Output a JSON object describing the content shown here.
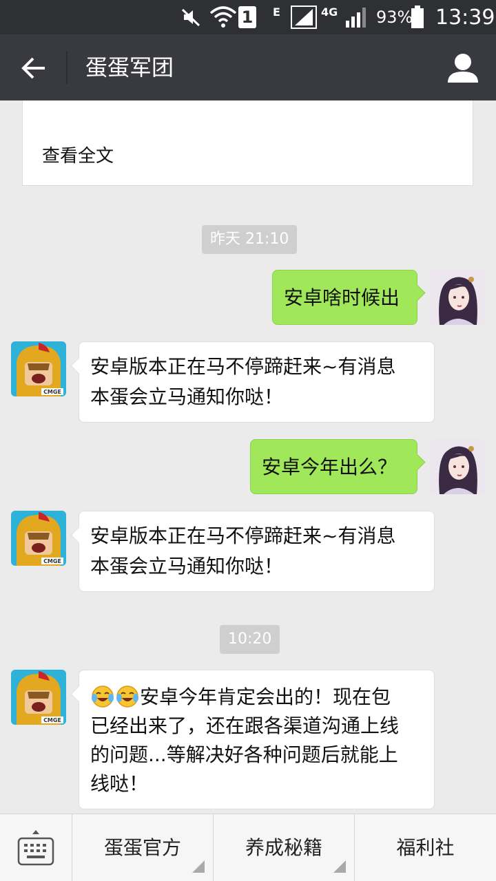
{
  "status_bar": {
    "sim_slot": "1",
    "network_e": "E",
    "network_4g": "4G",
    "battery_percent": "93%",
    "battery_level": 0.93,
    "time": "13:39"
  },
  "header": {
    "title": "蛋蛋军团",
    "back_icon": "arrow-left-icon",
    "profile_icon": "person-icon"
  },
  "article": {
    "read_all": "查看全文"
  },
  "messages": [
    {
      "type": "timestamp",
      "text": "昨天 21:10"
    },
    {
      "type": "sent",
      "text": "安卓啥时候出"
    },
    {
      "type": "received",
      "lines": [
        "安卓版本正在马不停蹄赶来~有消息",
        "本蛋会立马通知你哒！"
      ]
    },
    {
      "type": "sent",
      "text": "安卓今年出么？"
    },
    {
      "type": "received",
      "lines": [
        "安卓版本正在马不停蹄赶来~有消息",
        "本蛋会立马通知你哒！"
      ]
    },
    {
      "type": "timestamp",
      "text": "10:20"
    },
    {
      "type": "received",
      "emoji": "crying-laughing-emoji",
      "lines": [
        "安卓今年肯定会出的！现在包",
        "已经出来了，还在跟各渠道沟通上线",
        "的问题...等解决好各种问题后就能上",
        "线哒！"
      ]
    }
  ],
  "bottom_menu": {
    "keyboard_icon": "keyboard-icon",
    "items": [
      "蛋蛋官方",
      "养成秘籍",
      "福利社"
    ]
  },
  "avatar_label": "CMGE",
  "colors": {
    "status_bar": "#2e3033",
    "title_bar": "#393a3f",
    "chat_bg": "#ebebeb",
    "sent_bubble": "#a0e75a",
    "received_bubble": "#ffffff"
  }
}
